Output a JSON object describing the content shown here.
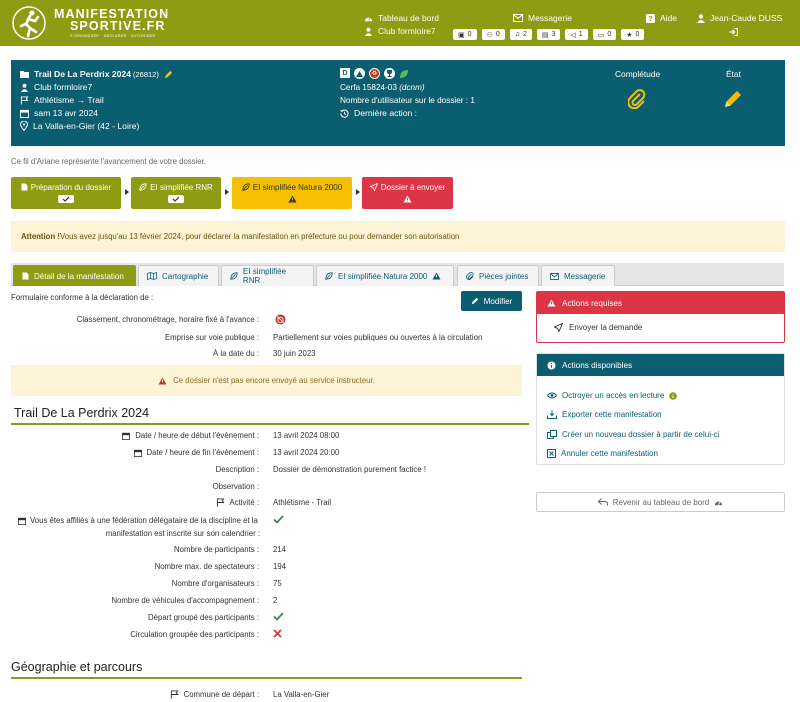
{
  "header": {
    "logo_line1": "MANIFESTATION",
    "logo_line2": "SPORTIVE.FR",
    "logo_tagline": "S'ORGANISER · DÉCLARER · AUTORISER",
    "dashboard": "Tableau de bord",
    "club": "Club formloire7",
    "messaging": "Messagerie",
    "help": "Aide",
    "user": "Jean-Caude DUSS",
    "counters": [
      {
        "icon": "inbox-icon",
        "value": "0"
      },
      {
        "icon": "road-icon",
        "value": "0"
      },
      {
        "icon": "bell-icon",
        "value": "2"
      },
      {
        "icon": "comment-icon",
        "value": "3"
      },
      {
        "icon": "megaphone-icon",
        "value": "1"
      },
      {
        "icon": "chat-icon",
        "value": "0"
      },
      {
        "icon": "star-icon",
        "value": "0"
      }
    ]
  },
  "dossier": {
    "title": "Trail De La Perdrix 2024",
    "id": "(26812)",
    "club": "Club formloire7",
    "activity": "Athlétisme → Trail",
    "date": "sam 13 avr 2024",
    "location": "La Valla-en-Gier (42 - Loire)",
    "cerfa": "Cerfa 15824-03",
    "cerfa_code": "(dcnm)",
    "users_label": "Nombre d'utilisateur sur le dossier : 1",
    "last_action_label": "Dernière action :",
    "completude": "Complétude",
    "etat": "État"
  },
  "breadcrumb_help": "Ce fil d'Ariane représente l'avancement de votre dossier.",
  "steps": [
    {
      "label": "Préparation du dossier",
      "status": "done",
      "color": "#8d9c12"
    },
    {
      "label": "EI simplifiée RNR",
      "status": "done",
      "color": "#8d9c12"
    },
    {
      "label": "EI simplifiée Natura 2000",
      "status": "warning",
      "color": "#f5c000"
    },
    {
      "label": "Dossier à envoyer",
      "status": "warning",
      "color": "#dc3545"
    }
  ],
  "alert": {
    "strong": "Attention !",
    "text": " Vous avez jusqu'au 13 février 2024, pour déclarer la manifestation en préfecture ou pour demander son autorisation"
  },
  "tabs": [
    {
      "label": "Détail de la manifestation",
      "active": true
    },
    {
      "label": "Cartographie"
    },
    {
      "label": "EI simplifiée RNR"
    },
    {
      "label": "EI simplifiée Natura 2000"
    },
    {
      "label": "Pièces jointes"
    },
    {
      "label": "Messagerie"
    }
  ],
  "form": {
    "conform_label": "Formulaire conforme à la déclaration de :",
    "modify": "Modifier",
    "classement_label": "Classement, chronométrage, horaire fixé à l'avance :",
    "emprise_label": "Emprise sur voie publique :",
    "emprise_value": "Partiellement sur voies publiques ou ouvertes à la circulation",
    "a_la_date_label": "À la date du :",
    "a_la_date_value": "30 juin 2023",
    "warning": "Ce dossier n'est pas encore envoyé au service instructeur."
  },
  "details": {
    "title": "Trail De La Perdrix 2024",
    "rows": [
      {
        "label": "Date / heure de début l'évènement :",
        "value": "13 avril 2024 08:00"
      },
      {
        "label": "Date / heure de fin l'évènement :",
        "value": "13 avril 2024 20:00"
      },
      {
        "label": "Description :",
        "value": "Dossier de démonstration purement factice !"
      },
      {
        "label": "Observation :",
        "value": ""
      },
      {
        "label": "Activité :",
        "value": "Athlétisme - Trail"
      },
      {
        "label_line1": "Vous êtes affiliés à une fédération délégataire de la discipline et la",
        "label_line2": "manifestation est inscrite sur son calendrier :"
      },
      {
        "label": "Nombre de participants :",
        "value": "214"
      },
      {
        "label": "Nombre max. de spectateurs :",
        "value": "194"
      },
      {
        "label": "Nombre d'organisateurs :",
        "value": "75"
      },
      {
        "label": "Nombre de véhicules d'accompagnement :",
        "value": "2"
      },
      {
        "label": "Départ groupé des participants :"
      },
      {
        "label": "Circulation groupée des participants :"
      }
    ]
  },
  "geo": {
    "title": "Géographie et parcours",
    "depart_label": "Commune de départ :",
    "depart_value": "La Valla-en-Gier"
  },
  "sidebar": {
    "required_title": "Actions requises",
    "send_request": "Envoyer la demande",
    "available_title": "Actions disponibles",
    "actions": [
      "Octroyer un accès en lecture",
      "Exporter cette manifestation",
      "Créer un nouveau dossier à partir de celui-ci",
      "Annuler cette manifestation"
    ],
    "back": "Revenir au tableau de bord"
  },
  "colors": {
    "olive": "#8d9c12",
    "teal": "#0b5d70",
    "red": "#dc3545",
    "yellow": "#f5c000",
    "green": "#2e8b57"
  }
}
